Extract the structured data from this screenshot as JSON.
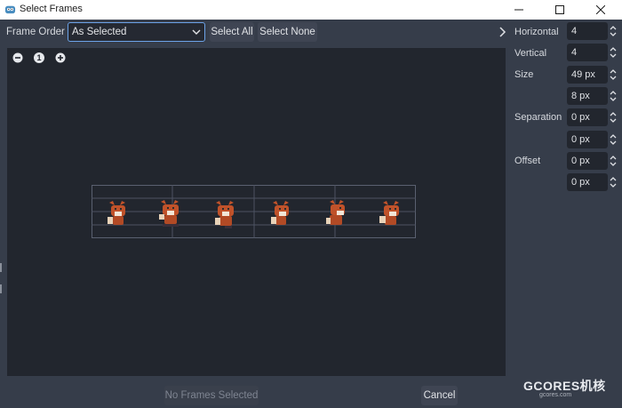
{
  "window": {
    "title": "Select Frames",
    "controls": [
      "minimize-icon",
      "maximize-icon",
      "close-icon"
    ]
  },
  "toolbar": {
    "frame_order_label": "Frame Order",
    "frame_order_value": "As Selected",
    "select_all_label": "Select All",
    "select_none_label": "Select None",
    "panel_toggle_icon": "chevron-right-icon"
  },
  "zoom": {
    "zoom_out_icon": "zoom-out-icon",
    "zoom_reset_label": "1",
    "zoom_in_icon": "zoom-in-icon"
  },
  "settings": {
    "horizontal": {
      "label": "Horizontal",
      "value": "4"
    },
    "vertical": {
      "label": "Vertical",
      "value": "4"
    },
    "size": {
      "label": "Size",
      "x": "49 px",
      "y": "8 px"
    },
    "separation": {
      "label": "Separation",
      "x": "0 px",
      "y": "0 px"
    },
    "offset": {
      "label": "Offset",
      "x": "0 px",
      "y": "0 px"
    }
  },
  "footer": {
    "status_button": "No Frames Selected",
    "cancel_label": "Cancel"
  },
  "watermark": {
    "text": "GCORES机核",
    "sub": "gcores.com"
  },
  "colors": {
    "background": "#363d4a",
    "viewport": "#22262e",
    "accent_border": "#6ca3e8",
    "fox_orange": "#c0522a"
  }
}
